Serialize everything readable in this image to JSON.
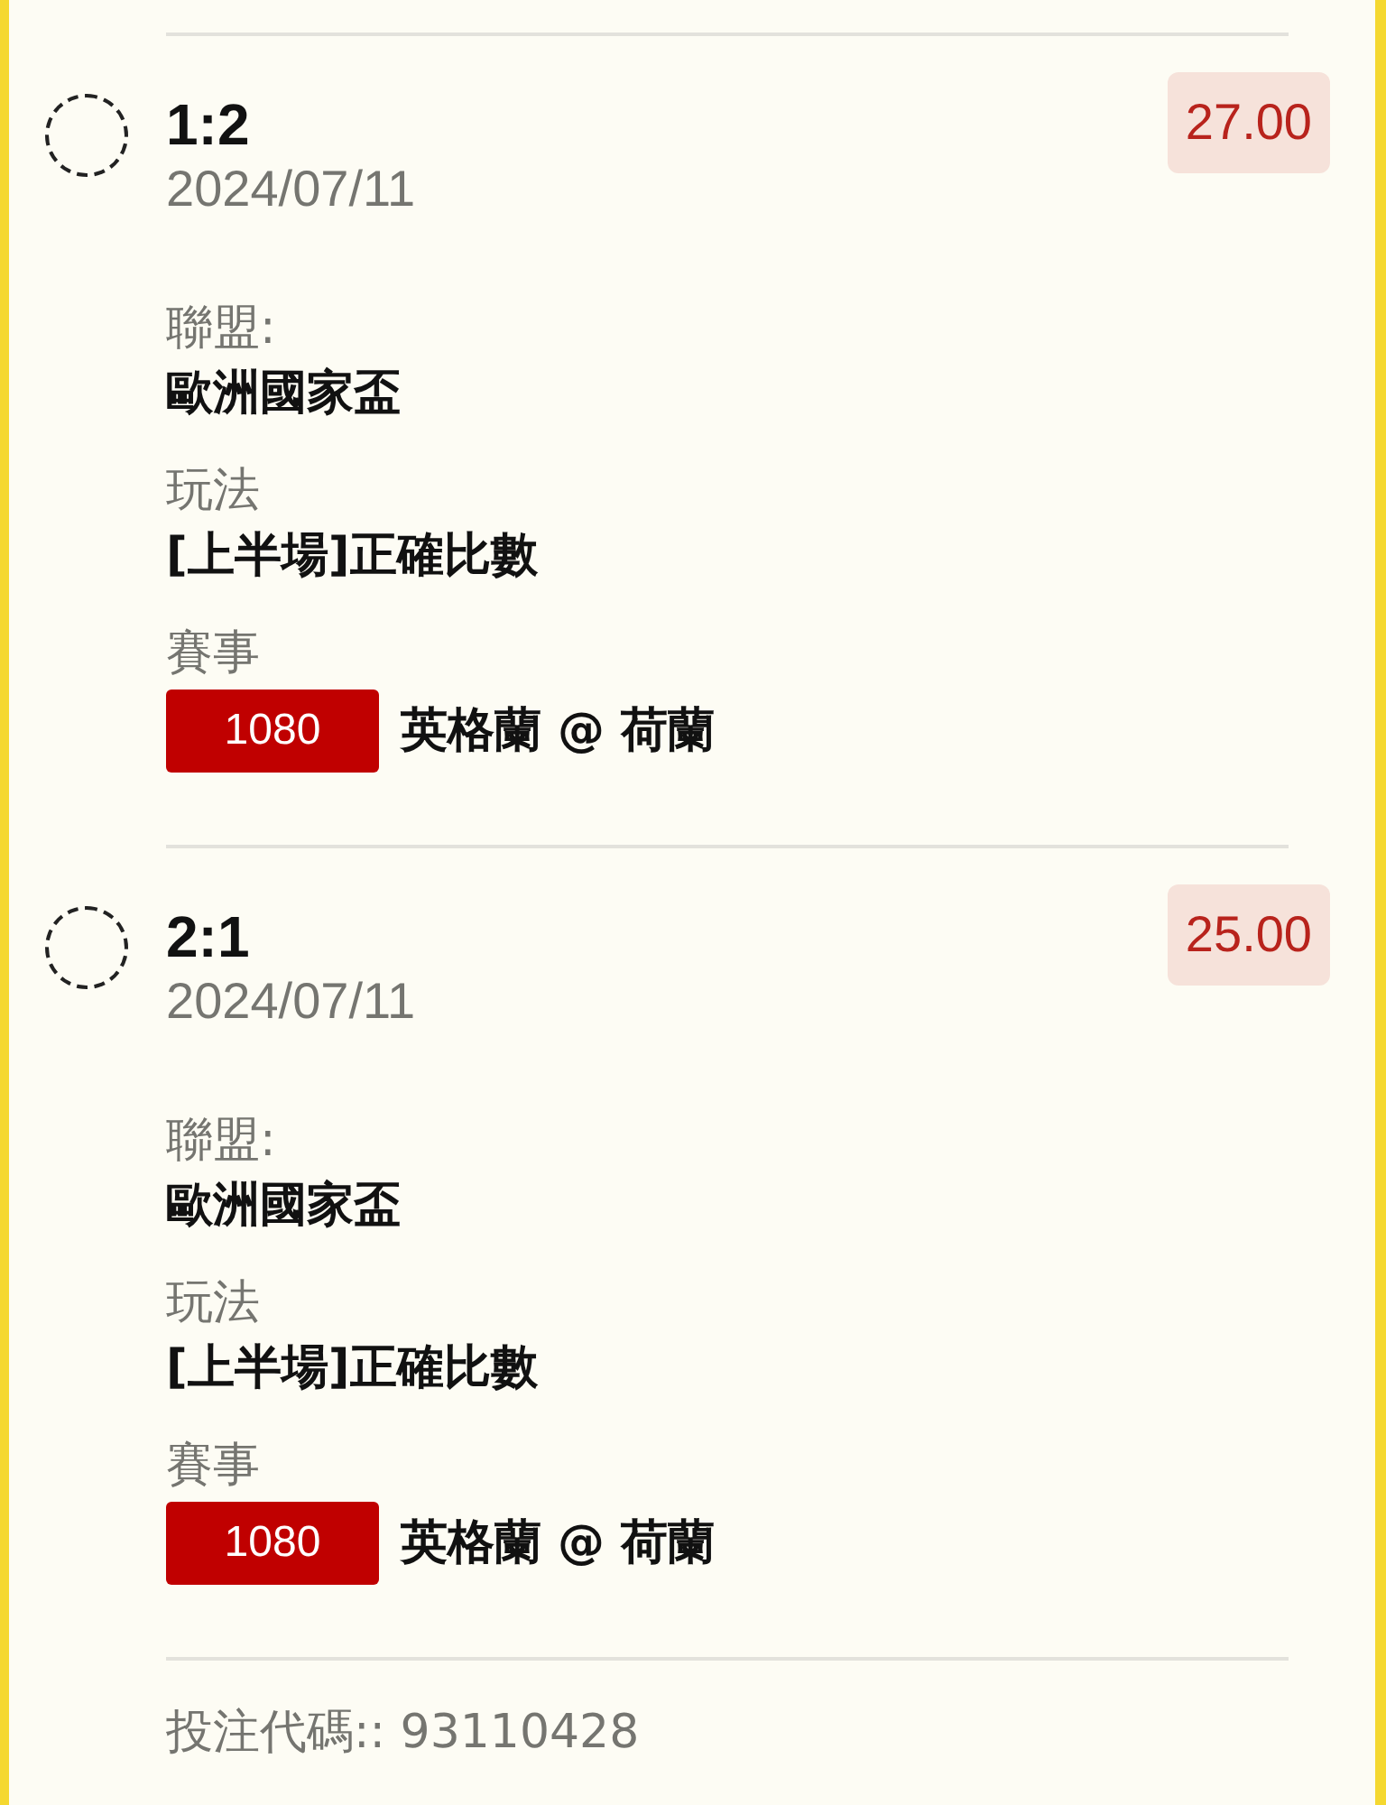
{
  "bets": [
    {
      "selected": false,
      "score": "1:2",
      "date": "2024/07/11",
      "odds": "27.00",
      "league_label": "聯盟:",
      "league": "歐洲國家盃",
      "play_label": "玩法",
      "play": "[上半場]正確比數",
      "event_label": "賽事",
      "match_no": "1080",
      "match": "英格蘭 @ 荷蘭"
    },
    {
      "selected": false,
      "score": "2:1",
      "date": "2024/07/11",
      "odds": "25.00",
      "league_label": "聯盟:",
      "league": "歐洲國家盃",
      "play_label": "玩法",
      "play": "[上半場]正確比數",
      "event_label": "賽事",
      "match_no": "1080",
      "match": "英格蘭 @ 荷蘭"
    }
  ],
  "bet_code": "投注代碼:: 93110428"
}
